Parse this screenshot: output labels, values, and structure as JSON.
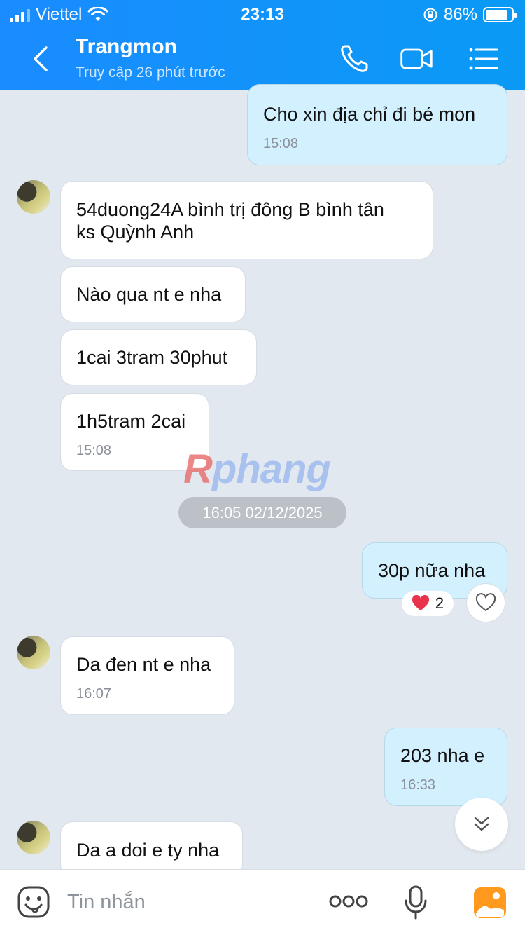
{
  "status_bar": {
    "carrier": "Viettel",
    "time": "23:13",
    "battery": "86%",
    "battery_level": 0.86
  },
  "header": {
    "title": "Trangmon",
    "subtitle": "Truy cập 26 phút trước",
    "icons": [
      "back-icon",
      "phone-icon",
      "video-call-icon",
      "menu-list-icon"
    ]
  },
  "messages": [
    {
      "dir": "out",
      "text": "Cho xin địa chỉ đi bé mon",
      "time": "15:08"
    },
    {
      "dir": "in",
      "text1": "54duong24A bình trị đông B bình tân",
      "text2": "ks Quỳnh Anh"
    },
    {
      "dir": "in",
      "text": "Nào qua nt e nha"
    },
    {
      "dir": "in",
      "text": "1cai 3tram 30phut"
    },
    {
      "dir": "in",
      "text": "1h5tram 2cai",
      "time": "15:08"
    },
    {
      "dir": "out",
      "text": "30p nữa nha",
      "reaction_count": "2"
    },
    {
      "dir": "in",
      "text": "Da đen nt e nha",
      "time": "16:07"
    },
    {
      "dir": "out",
      "text": "203 nha e",
      "time": "16:33"
    },
    {
      "dir": "in",
      "text": "Da a doi e ty nha"
    }
  ],
  "date_separator": "16:05 02/12/2025",
  "watermark": {
    "r": "R",
    "rest": "phang"
  },
  "input_bar": {
    "placeholder": "Tin nhắn",
    "icons": [
      "emoji-icon",
      "more-icon",
      "microphone-icon",
      "gallery-icon"
    ]
  },
  "colors": {
    "header_start": "#1a8cff",
    "header_end": "#0a9af5",
    "background": "#e2e8ef",
    "outgoing_bubble": "#d3f0ff",
    "incoming_bubble": "#ffffff",
    "reaction_heart": "#e8334a",
    "gallery_orange": "#ff9a1f"
  }
}
